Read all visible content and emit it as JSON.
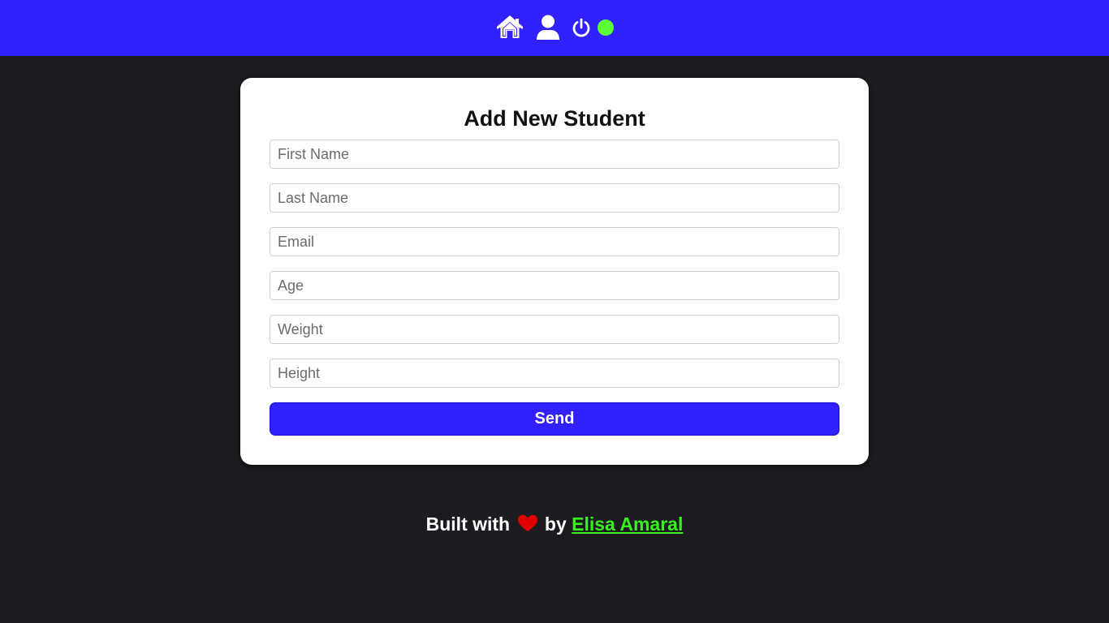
{
  "header": {
    "icons": [
      "home-icon",
      "user-icon",
      "power-icon"
    ],
    "status_color": "#5dfb3a",
    "background": "#3121ff"
  },
  "form": {
    "title": "Add New Student",
    "fields": {
      "first_name": {
        "placeholder": "First Name",
        "value": ""
      },
      "last_name": {
        "placeholder": "Last Name",
        "value": ""
      },
      "email": {
        "placeholder": "Email",
        "value": ""
      },
      "age": {
        "placeholder": "Age",
        "value": ""
      },
      "weight": {
        "placeholder": "Weight",
        "value": ""
      },
      "height": {
        "placeholder": "Height",
        "value": ""
      }
    },
    "submit_label": "Send",
    "button_color": "#3121ff"
  },
  "footer": {
    "prefix": "Built with",
    "icon": "heart-icon",
    "middle": "by",
    "author": "Elisa Amaral",
    "heart_color": "#e10000",
    "link_color": "#37f21d"
  }
}
